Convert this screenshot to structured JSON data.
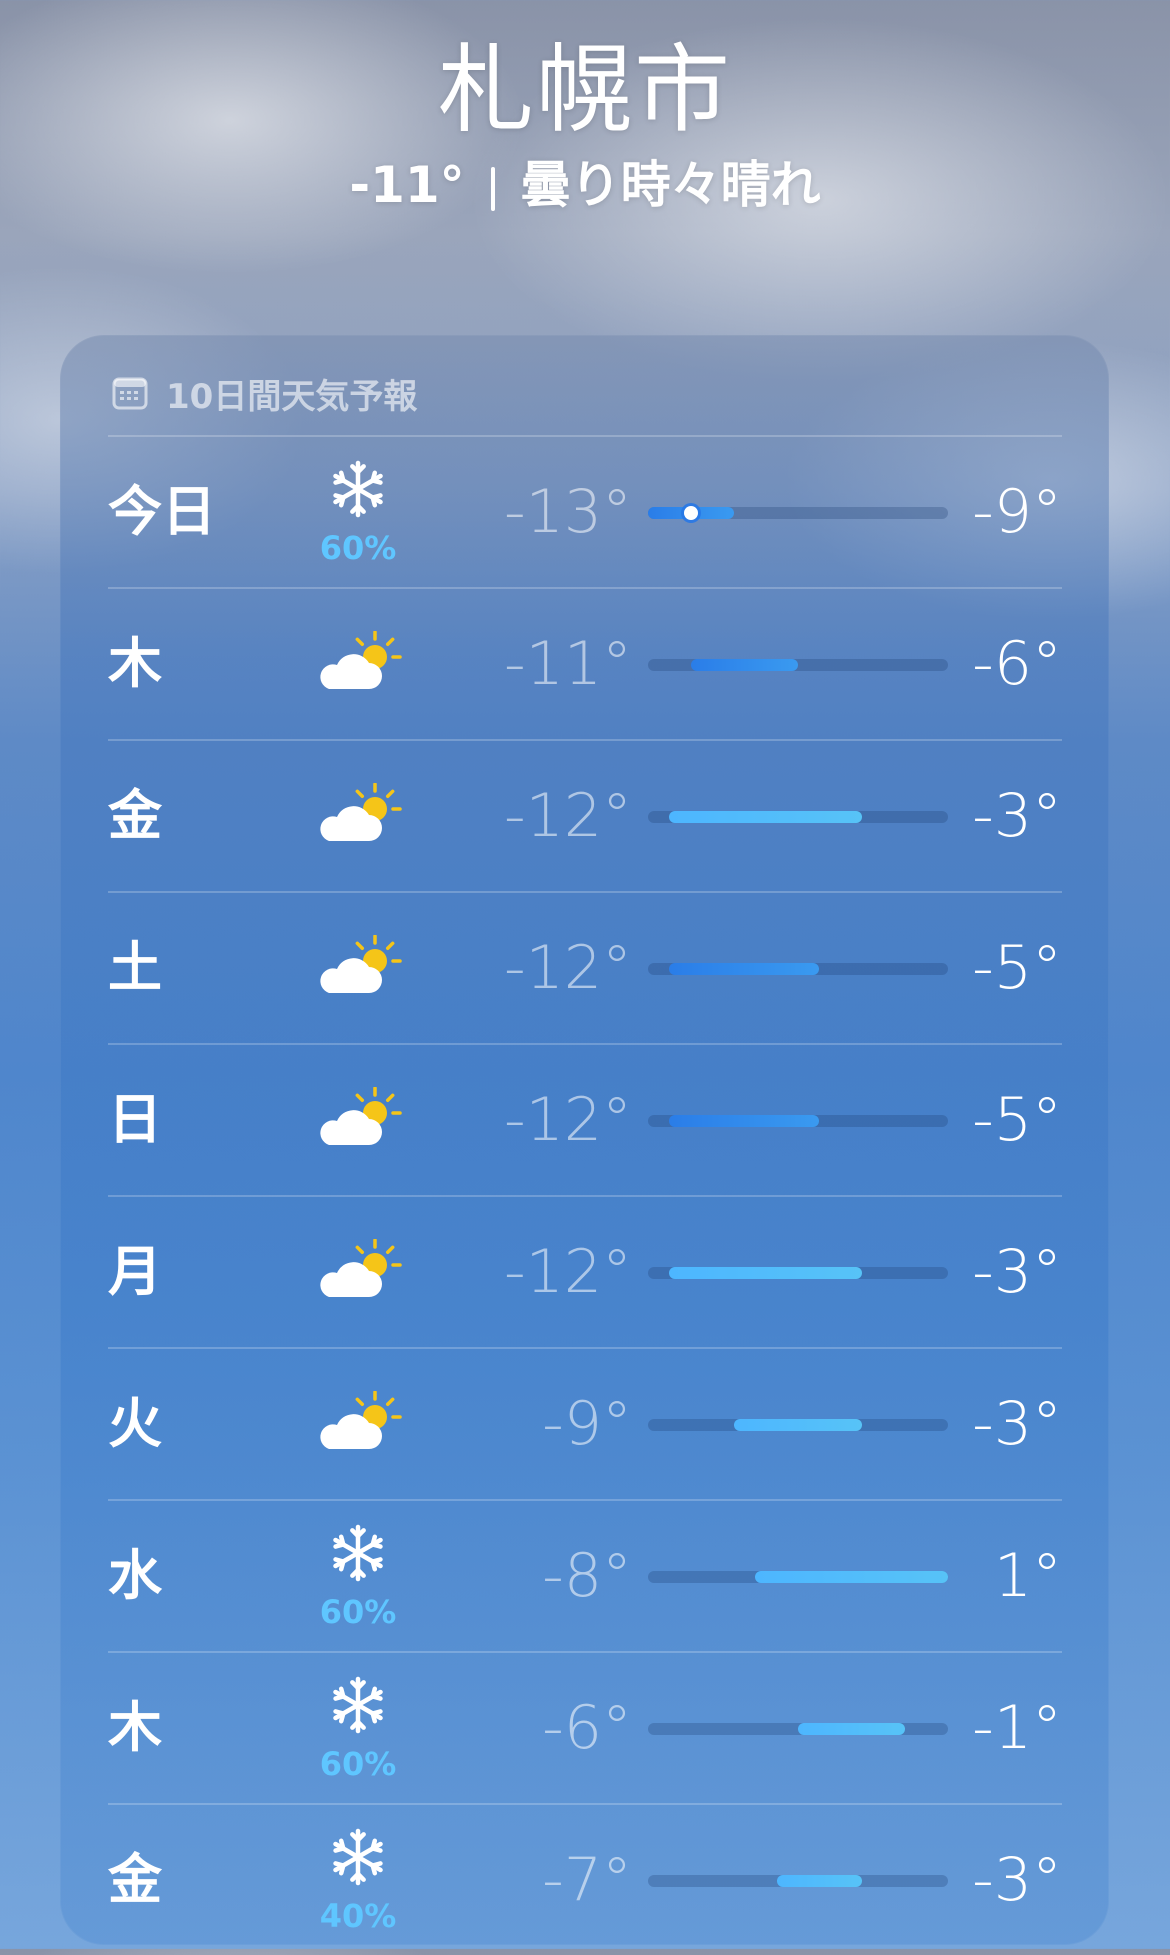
{
  "header": {
    "city": "札幌市",
    "current_temp": "-11°",
    "condition": "曇り時々晴れ"
  },
  "forecast": {
    "title": "10日間天気予報",
    "title_icon": "calendar-icon",
    "range_min": -13,
    "range_max": 1,
    "days": [
      {
        "day": "今日",
        "icon": "snowflake-icon",
        "pop": "60%",
        "low": "-13°",
        "high": "-9°",
        "low_val": -13,
        "high_val": -9,
        "current": -11
      },
      {
        "day": "木",
        "icon": "partly-cloudy-icon",
        "pop": "",
        "low": "-11°",
        "high": "-6°",
        "low_val": -11,
        "high_val": -6
      },
      {
        "day": "金",
        "icon": "partly-cloudy-icon",
        "pop": "",
        "low": "-12°",
        "high": "-3°",
        "low_val": -12,
        "high_val": -3
      },
      {
        "day": "土",
        "icon": "partly-cloudy-icon",
        "pop": "",
        "low": "-12°",
        "high": "-5°",
        "low_val": -12,
        "high_val": -5
      },
      {
        "day": "日",
        "icon": "partly-cloudy-icon",
        "pop": "",
        "low": "-12°",
        "high": "-5°",
        "low_val": -12,
        "high_val": -5
      },
      {
        "day": "月",
        "icon": "partly-cloudy-icon",
        "pop": "",
        "low": "-12°",
        "high": "-3°",
        "low_val": -12,
        "high_val": -3
      },
      {
        "day": "火",
        "icon": "partly-cloudy-icon",
        "pop": "",
        "low": "-9°",
        "high": "-3°",
        "low_val": -9,
        "high_val": -3
      },
      {
        "day": "水",
        "icon": "snowflake-icon",
        "pop": "60%",
        "low": "-8°",
        "high": "1°",
        "low_val": -8,
        "high_val": 1
      },
      {
        "day": "木",
        "icon": "snowflake-icon",
        "pop": "60%",
        "low": "-6°",
        "high": "-1°",
        "low_val": -6,
        "high_val": -1
      },
      {
        "day": "金",
        "icon": "snowflake-icon",
        "pop": "40%",
        "low": "-7°",
        "high": "-3°",
        "low_val": -7,
        "high_val": -3
      }
    ]
  },
  "colors": {
    "cold": "#2a7de8",
    "mild": "#4db6ff",
    "pop": "#5fc6ff",
    "sun": "#f5c518"
  }
}
